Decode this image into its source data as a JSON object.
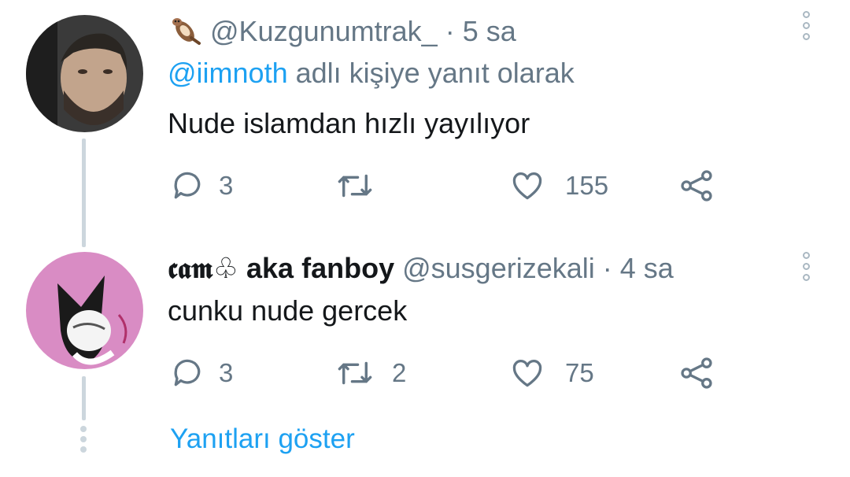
{
  "tweet1": {
    "handle": "@Kuzgunumtrak_",
    "separator": "·",
    "time": "5 sa",
    "reply_to_handle": "@iimnoth",
    "reply_to_suffix": "adlı kişiye yanıt olarak",
    "text": "Nude islamdan hızlı yayılıyor",
    "actions": {
      "replies": "3",
      "retweets": "",
      "likes": "155"
    },
    "emoji_icon": "otter-icon"
  },
  "tweet2": {
    "display_name": "𝖈𝖆𝖒♧ aka fanboy",
    "handle": "@susgerizekali",
    "separator": "·",
    "time": "4 sa",
    "text": "cunku nude gercek",
    "actions": {
      "replies": "3",
      "retweets": "2",
      "likes": "75"
    }
  },
  "show_replies_label": "Yanıtları göster",
  "colors": {
    "accent": "#1da1f2",
    "muted": "#657786",
    "thread_line": "#ccd6dd"
  }
}
